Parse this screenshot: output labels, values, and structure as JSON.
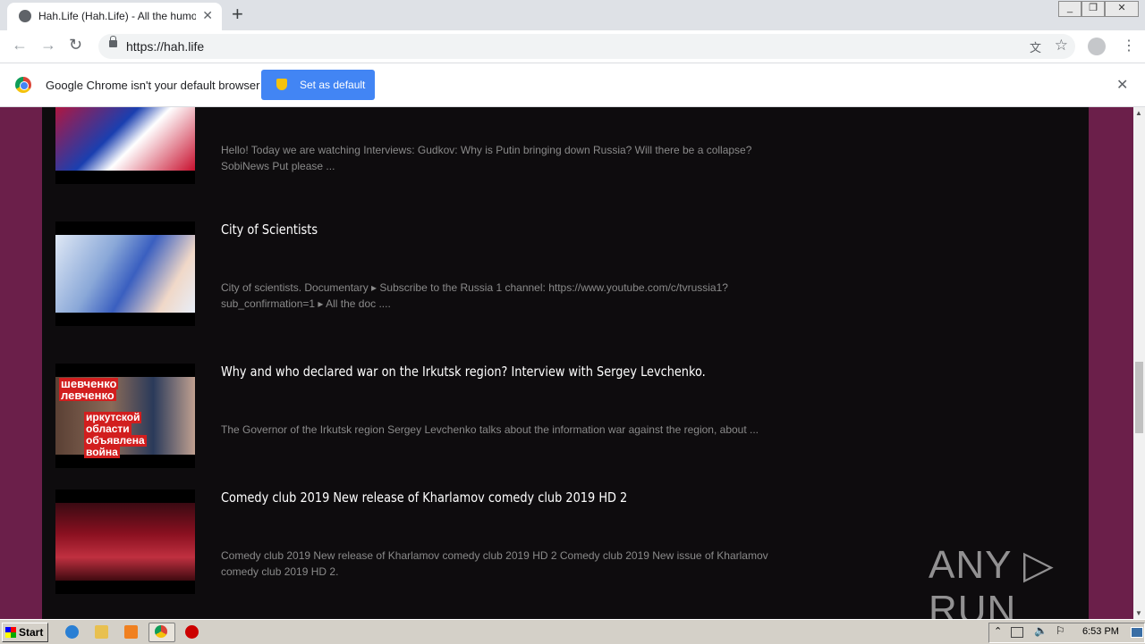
{
  "browser": {
    "tab_title": "Hah.Life (Hah.Life) - All the humor in",
    "url": "https://hah.life",
    "new_tab_glyph": "+",
    "tab_close_glyph": "✕",
    "back_glyph": "←",
    "forward_glyph": "→",
    "reload_glyph": "↻",
    "translate_glyph": "文",
    "star_glyph": "☆",
    "menu_glyph": "⋮"
  },
  "infobar": {
    "message": "Google Chrome isn't your default browser",
    "button": "Set as default",
    "close_glyph": "✕"
  },
  "items": [
    {
      "title": "",
      "desc": "Hello! Today we are watching Interviews: Gudkov: Why is Putin bringing down Russia? Will there be a collapse? SobiNews Put please ..."
    },
    {
      "title": "City of Scientists",
      "desc": "City of scientists. Documentary ▸ Subscribe to the Russia 1 channel: https://www.youtube.com/c/tvrussia1?sub_confirmation=1 ▸ All the doc ...."
    },
    {
      "title": "Why and who declared war on the Irkutsk region? Interview with Sergey Levchenko.",
      "thumb_text": [
        "шевченко",
        "левченко",
        "иркутской",
        "области",
        "объявлена",
        "война"
      ],
      "desc": "The Governor of the Irkutsk region Sergey Levchenko talks about the information war against the region, about ..."
    },
    {
      "title": "Comedy club 2019 New release of Kharlamov comedy club 2019 HD 2",
      "desc": "Comedy club 2019 New release of Kharlamov comedy club 2019 HD 2 Comedy club 2019 New issue of Kharlamov comedy club 2019 HD 2."
    }
  ],
  "watermark": "ANY ▷ RUN",
  "taskbar": {
    "start": "Start",
    "clock": "6:53 PM"
  },
  "colors": {
    "page_bg": "#6b1f4a",
    "panel_bg": "#0e0c0e",
    "button_blue": "#4285f4"
  }
}
